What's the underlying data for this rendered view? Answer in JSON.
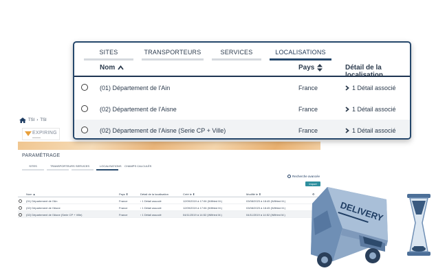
{
  "background_app": {
    "breadcrumb": [
      "TSI",
      "TSI"
    ],
    "logo": {
      "name": "EXPIRING"
    },
    "page_title": "PARAMÉTRAGE",
    "tabs": [
      "SITES",
      "TRANSPORTEURS",
      "SERVICES",
      "LOCALISATIONS",
      "CHAMPS CALCULÉS"
    ],
    "active_tab": "LOCALISATIONS",
    "advanced_search": "Recherche avancée",
    "import_button": "Import",
    "columns": [
      "Nom",
      "Pays",
      "Détail de la localisation",
      "Créé le",
      "Modifié le"
    ],
    "rows": [
      {
        "name": "(01) Département de l'Ain",
        "pays": "France",
        "detail": "1 Détail associé",
        "cree": "12/09/2019 à 17:06 (Wilfried M.)",
        "modifie": "03/08/2023 à 18:45 (Wilfried M.)"
      },
      {
        "name": "(02) Département de l'Aisne",
        "pays": "France",
        "detail": "1 Détail associé",
        "cree": "12/09/2019 à 17:06 (Wilfried M.)",
        "modifie": "03/08/2023 à 18:45 (Wilfried M.)"
      },
      {
        "name": "(02) Département de l'Aisne (Serie CP + Ville)",
        "pays": "France",
        "detail": "1 Détail associé",
        "cree": "04/11/2019 à 14:52 (Wilfried M.)",
        "modifie": "04/11/2019 à 14:52 (Wilfried M.)"
      }
    ]
  },
  "zoom_panel": {
    "tabs": [
      "SITES",
      "TRANSPORTEURS",
      "SERVICES",
      "LOCALISATIONS"
    ],
    "active_tab": "LOCALISATIONS",
    "columns": {
      "nom": "Nom",
      "pays": "Pays",
      "detail": "Détail de la localisation"
    },
    "rows": [
      {
        "name": "(01) Département de l'Ain",
        "pays": "France",
        "detail": "1 Détail associé"
      },
      {
        "name": "(02) Département de l'Aisne",
        "pays": "France",
        "detail": "1 Détail associé"
      },
      {
        "name": "(02) Département de l'Aisne (Serie CP + Ville)",
        "pays": "France",
        "detail": "1 Détail associé"
      }
    ]
  },
  "illustration": {
    "van_label": "DELIVERY"
  },
  "colors": {
    "navy": "#25476b",
    "teal": "#2e8f9e",
    "van": "#6f8fb5",
    "sand": "#e8a03c"
  }
}
